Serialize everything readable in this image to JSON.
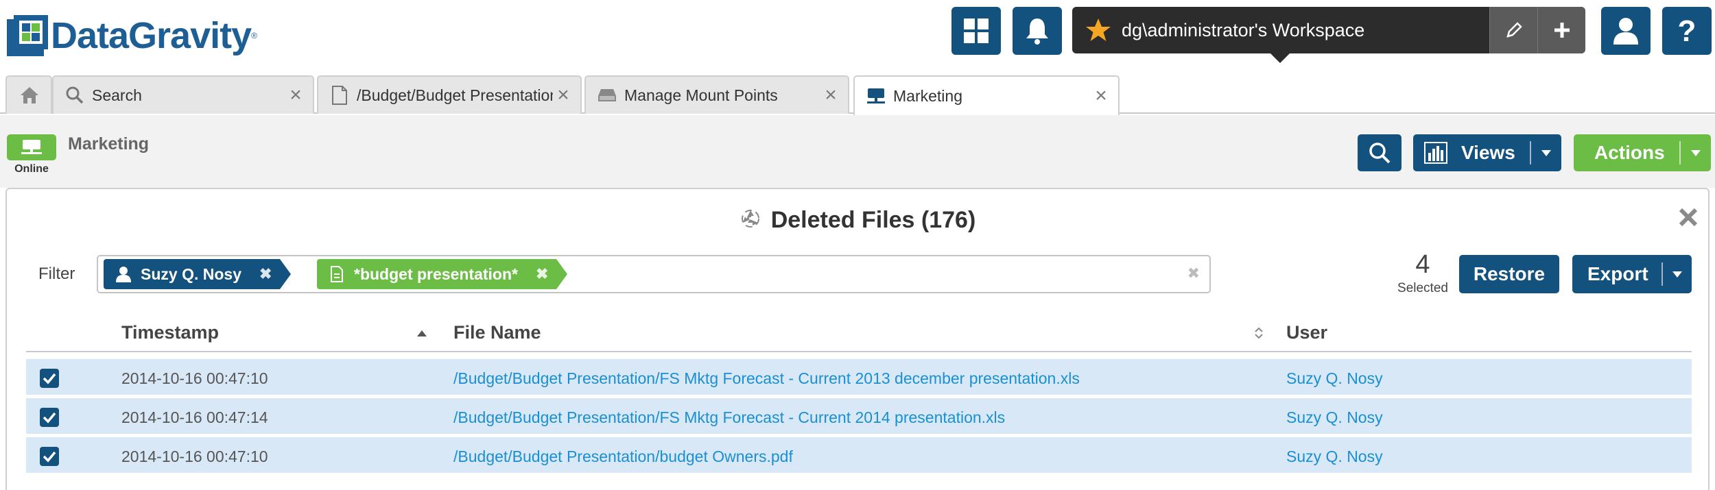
{
  "app": {
    "brand": "DataGravity",
    "brand_mark": "®"
  },
  "header": {
    "workspace_label": "dg\\administrator's Workspace",
    "icons": [
      "grid-icon",
      "bell-icon",
      "star-icon",
      "pencil-icon",
      "plus-icon",
      "user-icon",
      "help-icon"
    ]
  },
  "tabs": [
    {
      "label": "",
      "icon": "home-icon"
    },
    {
      "label": "Search",
      "icon": "search-icon"
    },
    {
      "label": "/Budget/Budget Presentation/FS Mktg Forecast",
      "icon": "document-icon"
    },
    {
      "label": "Manage Mount Points",
      "icon": "drive-icon"
    },
    {
      "label": "Marketing",
      "icon": "share-icon"
    }
  ],
  "subheader": {
    "status": "Online",
    "share_name": "Marketing",
    "views_label": "Views",
    "actions_label": "Actions"
  },
  "panel": {
    "title": "Deleted Files (176)",
    "filter_label": "Filter",
    "filters": [
      {
        "label": "Suzy Q. Nosy",
        "type": "user"
      },
      {
        "label": "*budget presentation*",
        "type": "file"
      }
    ],
    "selected_count": "4",
    "selected_label": "Selected",
    "restore_label": "Restore",
    "export_label": "Export"
  },
  "table": {
    "columns": [
      "Timestamp",
      "File Name",
      "User"
    ],
    "rows": [
      {
        "timestamp": "2014-10-16 00:47:10",
        "file": "/Budget/Budget Presentation/FS Mktg Forecast - Current 2013 december presentation.xls",
        "user": "Suzy Q. Nosy",
        "checked": true
      },
      {
        "timestamp": "2014-10-16 00:47:14",
        "file": "/Budget/Budget Presentation/FS Mktg Forecast - Current 2014 presentation.xls",
        "user": "Suzy Q. Nosy",
        "checked": true
      },
      {
        "timestamp": "2014-10-16 00:47:10",
        "file": "/Budget/Budget Presentation/budget Owners.pdf",
        "user": "Suzy Q. Nosy",
        "checked": true
      }
    ]
  },
  "colors": {
    "brand_blue": "#13527f",
    "brand_green": "#6cbd45",
    "link_blue": "#1a8fd1",
    "row_selected": "#d9e8f6",
    "workspace_bg": "#2c2c2c",
    "star": "#f5a623"
  }
}
